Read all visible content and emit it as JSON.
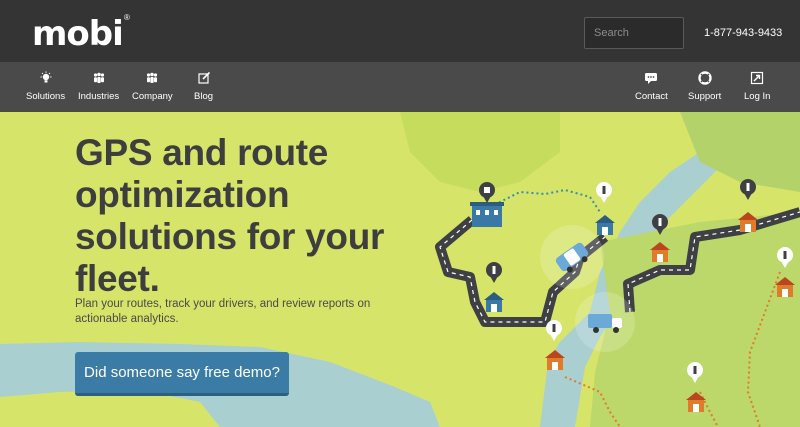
{
  "brand": {
    "logo_text": "mobi",
    "trademark": "®"
  },
  "header": {
    "search_placeholder": "Search",
    "phone": "1-877-943-9433"
  },
  "nav": {
    "left": [
      {
        "label": "Solutions",
        "icon": "lightbulb-icon"
      },
      {
        "label": "Industries",
        "icon": "people-icon"
      },
      {
        "label": "Company",
        "icon": "team-icon"
      },
      {
        "label": "Blog",
        "icon": "edit-icon"
      }
    ],
    "right": [
      {
        "label": "Contact",
        "icon": "chat-icon"
      },
      {
        "label": "Support",
        "icon": "lifebuoy-icon"
      },
      {
        "label": "Log In",
        "icon": "login-icon"
      }
    ]
  },
  "hero": {
    "headline": "GPS and route optimization solutions for your fleet.",
    "subtext": "Plan your routes, track your drivers, and review reports on actionable analytics.",
    "cta_label": "Did someone say free demo?"
  },
  "colors": {
    "topbar": "#343434",
    "navbar": "#4a4a4a",
    "land": "#d6e46a",
    "land_dark": "#b9d466",
    "water": "#a9cfd0",
    "road": "#3f4044",
    "accent": "#3a7ca5"
  }
}
